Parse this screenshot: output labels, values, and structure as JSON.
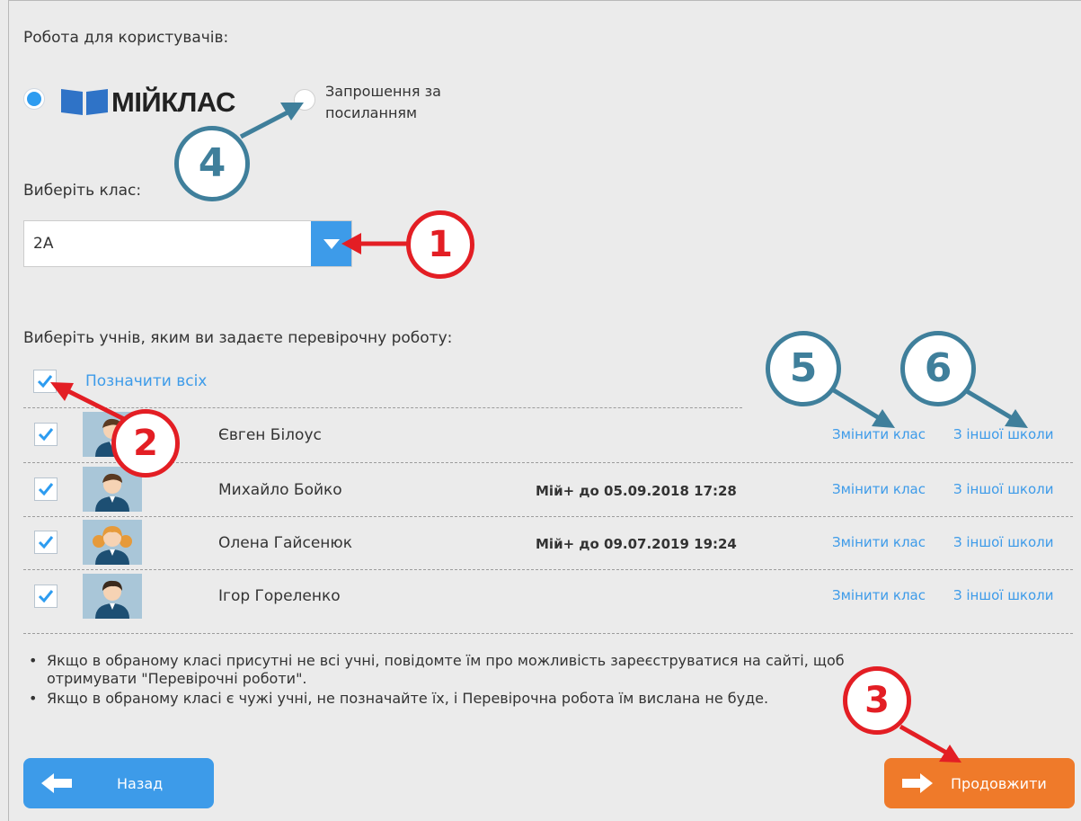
{
  "section_title": "Робота для користувачів:",
  "source_options": {
    "myclass_logo_text": "МІЙКЛАС",
    "invite_label_line1": "Запрошення за",
    "invite_label_line2": "посиланням"
  },
  "class_select": {
    "label": "Виберіть клас:",
    "value": "2А"
  },
  "students_prompt": "Виберіть учнів, яким ви задаєте перевірочну роботу:",
  "select_all_label": "Позначити всіх",
  "students": [
    {
      "name": "Євген Білоус",
      "subscription": "",
      "change_class": "Змінити клас",
      "other_school": "З іншої школи"
    },
    {
      "name": "Михайло Бойко",
      "subscription": "Мій+ до 05.09.2018 17:28",
      "change_class": "Змінити клас",
      "other_school": "З іншої школи"
    },
    {
      "name": "Олена Гайсенюк",
      "subscription": "Мій+ до 09.07.2019 19:24",
      "change_class": "Змінити клас",
      "other_school": "З іншої школи"
    },
    {
      "name": "Ігор Гореленко",
      "subscription": "",
      "change_class": "Змінити клас",
      "other_school": "З іншої школи"
    }
  ],
  "notes": {
    "note1_line1": "Якщо в обраному класі присутні не всі учні, повідомте їм про можливість зареєструватися на сайті, щоб",
    "note1_line2": "отримувати \"Перевірочні роботи\".",
    "note2": "Якщо в обраному класі є чужі учні, не позначайте їх, і Перевірочна робота їм вислана не буде."
  },
  "buttons": {
    "back": "Назад",
    "continue": "Продовжити"
  },
  "callouts": {
    "c1": "1",
    "c2": "2",
    "c3": "3",
    "c4": "4",
    "c5": "5",
    "c6": "6"
  },
  "colors": {
    "accent_blue": "#3d9be9",
    "orange": "#ef7a2a",
    "callout_red": "#e31e24",
    "callout_blue": "#3f7f9b",
    "background": "#ebebeb"
  }
}
